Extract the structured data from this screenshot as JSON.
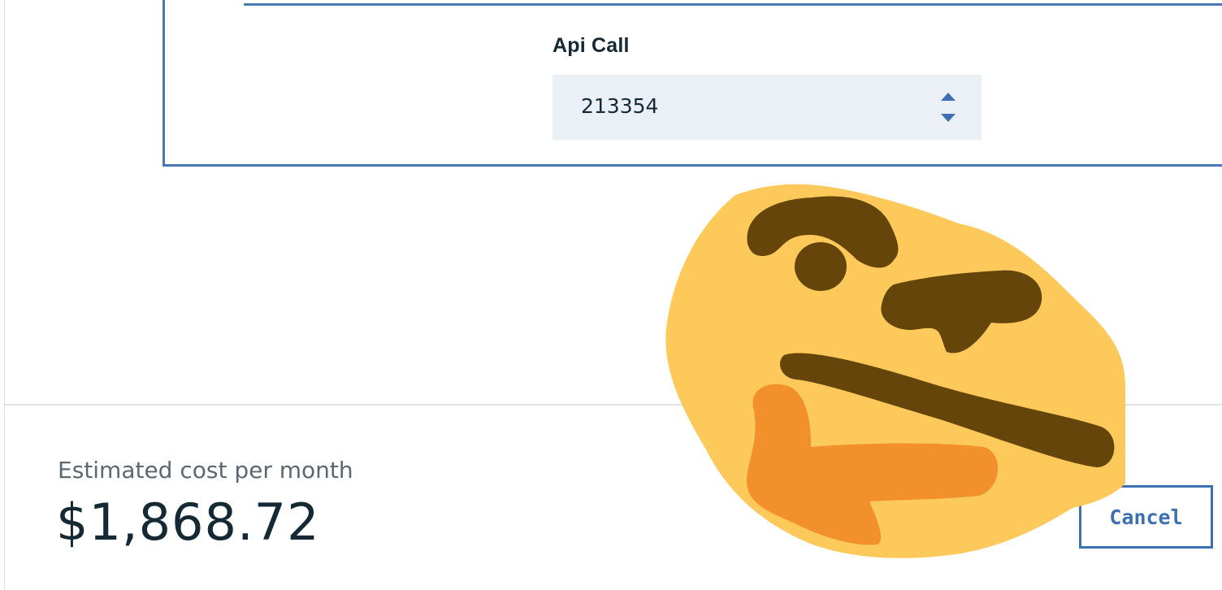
{
  "form": {
    "field_label": "Api Call",
    "field_value": "213354"
  },
  "summary": {
    "label": "Estimated cost per month",
    "value": "$1,868.72"
  },
  "actions": {
    "cancel_label": "Cancel"
  },
  "icons": {
    "stepper_up": "caret-up-icon",
    "stepper_down": "caret-down-icon",
    "overlay": "thinking-face-emoji"
  },
  "colors": {
    "accent": "#3d70b2",
    "panel_border": "#4a78b5",
    "input_bg": "#ebf0f7",
    "text_primary": "#152935",
    "text_secondary": "#5a6872",
    "emoji_face": "#fdc95a",
    "emoji_features": "#65450a",
    "emoji_hand": "#f2902c"
  }
}
